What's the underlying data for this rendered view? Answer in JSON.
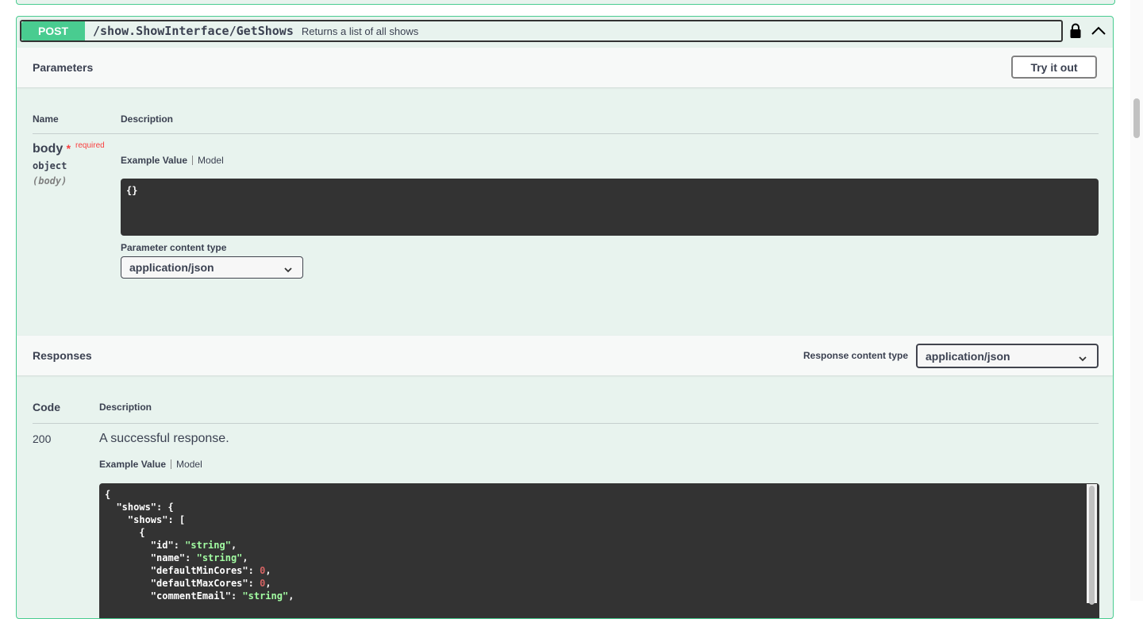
{
  "operation": {
    "method": "POST",
    "path": "/show.ShowInterface/GetShows",
    "summary": "Returns a list of all shows"
  },
  "parameters": {
    "title": "Parameters",
    "try_label": "Try it out",
    "col_name": "Name",
    "col_description": "Description",
    "param": {
      "name": "body",
      "star": "*",
      "required": "required",
      "type": "object",
      "location": "(body)"
    },
    "tab_example": "Example Value",
    "tab_model": "Model",
    "example_body": "{}",
    "content_type_label": "Parameter content type",
    "content_type_value": "application/json"
  },
  "responses": {
    "title": "Responses",
    "content_type_label": "Response content type",
    "content_type_value": "application/json",
    "col_code": "Code",
    "col_description": "Description",
    "code": "200",
    "description": "A successful response.",
    "tab_example": "Example Value",
    "tab_model": "Model",
    "json_lines": [
      [
        {
          "t": "{",
          "c": "k"
        }
      ],
      [
        {
          "t": "  \"shows\": {",
          "c": "k"
        }
      ],
      [
        {
          "t": "    \"shows\": [",
          "c": "k"
        }
      ],
      [
        {
          "t": "      {",
          "c": "k"
        }
      ],
      [
        {
          "t": "        \"id\": ",
          "c": "k"
        },
        {
          "t": "\"string\"",
          "c": "s"
        },
        {
          "t": ",",
          "c": "k"
        }
      ],
      [
        {
          "t": "        \"name\": ",
          "c": "k"
        },
        {
          "t": "\"string\"",
          "c": "s"
        },
        {
          "t": ",",
          "c": "k"
        }
      ],
      [
        {
          "t": "        \"defaultMinCores\": ",
          "c": "k"
        },
        {
          "t": "0",
          "c": "n"
        },
        {
          "t": ",",
          "c": "k"
        }
      ],
      [
        {
          "t": "        \"defaultMaxCores\": ",
          "c": "k"
        },
        {
          "t": "0",
          "c": "n"
        },
        {
          "t": ",",
          "c": "k"
        }
      ],
      [
        {
          "t": "        \"commentEmail\": ",
          "c": "k"
        },
        {
          "t": "\"string\"",
          "c": "s"
        },
        {
          "t": ",",
          "c": "k"
        }
      ]
    ]
  },
  "colors": {
    "post_green": "#49cc90",
    "block_bg": "#e8f3ee",
    "code_bg": "#333333"
  },
  "icons": [
    "lock-icon",
    "chevron-up-icon",
    "chevron-down-icon"
  ]
}
